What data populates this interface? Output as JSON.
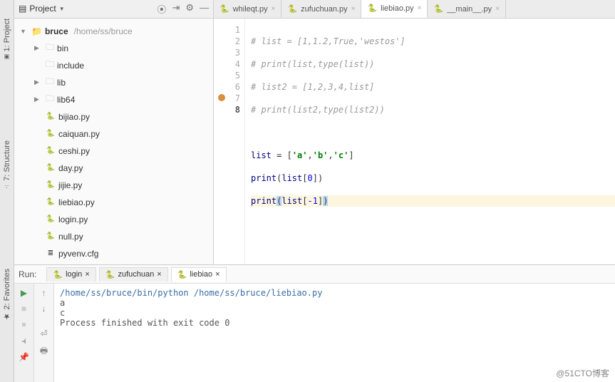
{
  "sidebar_tabs": [
    "1: Project",
    "7: Structure",
    "2: Favorites"
  ],
  "project": {
    "title": "Project",
    "root": {
      "name": "bruce",
      "path": "/home/ss/bruce"
    },
    "folders": [
      {
        "name": "bin"
      },
      {
        "name": "include"
      },
      {
        "name": "lib"
      },
      {
        "name": "lib64"
      }
    ],
    "files": [
      {
        "name": "bijiao.py"
      },
      {
        "name": "caiquan.py"
      },
      {
        "name": "ceshi.py"
      },
      {
        "name": "day.py"
      },
      {
        "name": "jijie.py"
      },
      {
        "name": "liebiao.py"
      },
      {
        "name": "login.py"
      },
      {
        "name": "null.py"
      },
      {
        "name": "pyvenv.cfg"
      }
    ]
  },
  "editor_tabs": [
    {
      "label": "whileqt.py",
      "active": false
    },
    {
      "label": "zufuchuan.py",
      "active": false
    },
    {
      "label": "liebiao.py",
      "active": true
    },
    {
      "label": "__main__.py",
      "active": false
    }
  ],
  "code": {
    "lines": [
      "# list = [1,1.2,True,'westos']",
      "# print(list,type(list))",
      "# list2 = [1,2,3,4,list]",
      "# print(list2,type(list2))",
      "",
      "list = ['a','b','c']",
      "print(list[0])",
      "print(list[-1])"
    ],
    "current_line": 8
  },
  "run": {
    "label": "Run:",
    "tabs": [
      {
        "label": "login",
        "active": false
      },
      {
        "label": "zufuchuan",
        "active": false
      },
      {
        "label": "liebiao",
        "active": true
      }
    ],
    "command": "/home/ss/bruce/bin/python /home/ss/bruce/liebiao.py",
    "output": [
      "a",
      "c",
      "",
      "Process finished with exit code 0"
    ]
  },
  "watermark": "@51CTO博客"
}
